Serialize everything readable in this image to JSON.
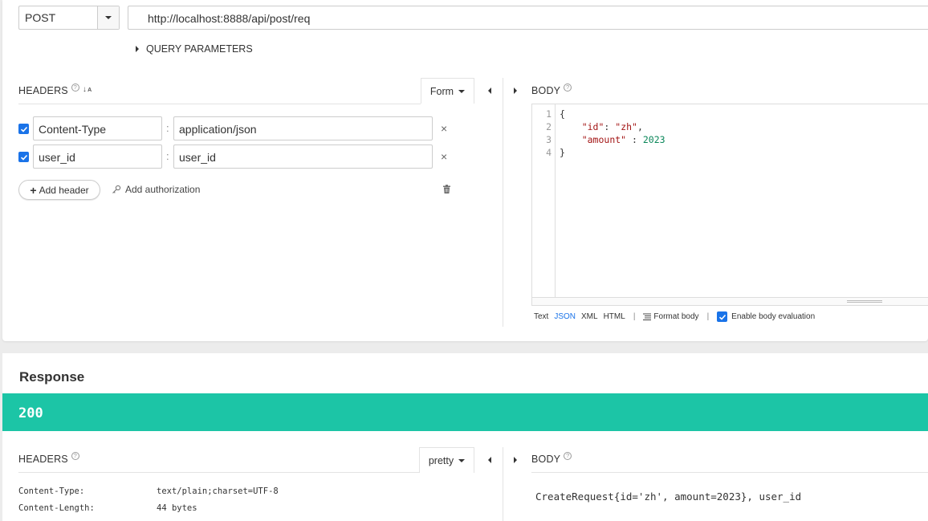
{
  "request": {
    "method": "POST",
    "url": "http://localhost:8888/api/post/req",
    "query_params_label": "QUERY PARAMETERS",
    "headers_title": "HEADERS",
    "headers_mode": "Form",
    "headers": [
      {
        "enabled": true,
        "name": "Content-Type",
        "value": "application/json"
      },
      {
        "enabled": true,
        "name": "user_id",
        "value": "user_id"
      }
    ],
    "add_header_label": "Add header",
    "add_auth_label": "Add authorization",
    "body_title": "BODY",
    "body_lines": [
      {
        "num": "1",
        "text": "{"
      },
      {
        "num": "2",
        "key": "\"id\"",
        "sep": ": ",
        "val": "\"zh\"",
        "end": ","
      },
      {
        "num": "3",
        "key": "\"amount\"",
        "sep": " : ",
        "val": "2023",
        "end": ""
      },
      {
        "num": "4",
        "text": "}"
      }
    ],
    "body_formats": {
      "text": "Text",
      "json": "JSON",
      "xml": "XML",
      "html": "HTML"
    },
    "active_format": "JSON",
    "format_body_label": "Format body",
    "enable_eval_label": "Enable body evaluation",
    "enable_eval_checked": true
  },
  "response": {
    "title": "Response",
    "status": "200",
    "status_color": "#1cc5a6",
    "headers_title": "HEADERS",
    "headers_mode": "pretty",
    "headers": [
      {
        "name": "Content-Type:",
        "value": "text/plain;charset=UTF-8"
      },
      {
        "name": "Content-Length:",
        "value": "44 bytes"
      }
    ],
    "body_title": "BODY",
    "body": "CreateRequest{id='zh', amount=2023}, user_id"
  },
  "icons": [
    "caret-down-icon",
    "triangle-right-icon",
    "help-icon",
    "sort-alpha-icon",
    "checkbox-checked-icon",
    "close-icon",
    "plus-icon",
    "key-icon",
    "trash-icon",
    "collapse-left-icon",
    "expand-right-icon",
    "format-lines-icon"
  ],
  "accent_color": "#1a73e8"
}
